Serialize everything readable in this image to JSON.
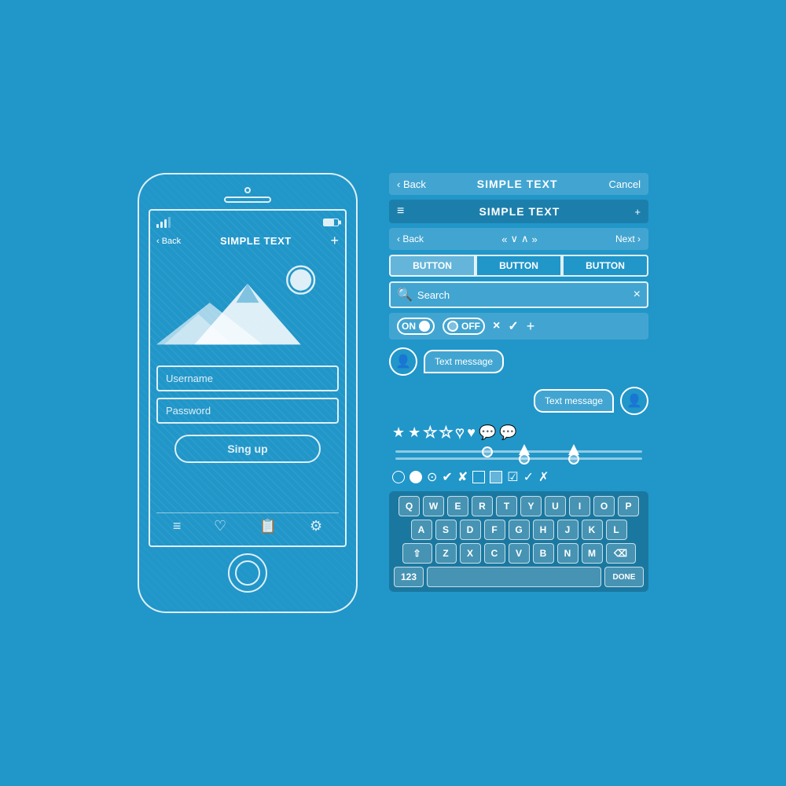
{
  "phone": {
    "nav": {
      "back_label": "‹ Back",
      "title": "SIMPLE TEXT",
      "plus_label": "+"
    },
    "status": {
      "signal": "signal",
      "battery": "battery"
    },
    "image_alt": "landscape photo placeholder",
    "username_placeholder": "Username",
    "password_placeholder": "Password",
    "signup_label": "Sing up",
    "tabs": [
      "menu",
      "heart",
      "list",
      "gear"
    ],
    "home_button": "home"
  },
  "ui_panel": {
    "row1": {
      "back": "‹ Back",
      "title": "SIMPLE TEXT",
      "cancel": "Cancel"
    },
    "row2": {
      "hamburger": "≡",
      "title": "SIMPLE TEXT",
      "plus": "+"
    },
    "row3": {
      "back": "‹ Back",
      "prev_prev": "«",
      "down": "∨",
      "up": "∧",
      "next_next": "»",
      "next": "Next ›"
    },
    "buttons": {
      "btn1": "BUTTON",
      "btn2": "BUTTON",
      "btn3": "BUTTON"
    },
    "search": {
      "placeholder": "Search",
      "clear": "×"
    },
    "toggles": {
      "on_label": "ON",
      "off_label": "OFF",
      "close": "×",
      "check": "✓",
      "plus": "+"
    },
    "chat": {
      "message1": "Text message",
      "message2": "Text message"
    },
    "stars": {
      "filled": 2,
      "half": 1,
      "empty": 2
    },
    "keyboard": {
      "row1": [
        "Q",
        "W",
        "E",
        "R",
        "T",
        "Y",
        "U",
        "I",
        "O",
        "P"
      ],
      "row2": [
        "A",
        "S",
        "D",
        "F",
        "G",
        "H",
        "J",
        "K",
        "L"
      ],
      "row3_special": "⇧",
      "row3": [
        "Z",
        "X",
        "C",
        "V",
        "B",
        "N",
        "M"
      ],
      "row3_del": "⌫",
      "numbers": "123",
      "space": "",
      "done": "DONE"
    }
  }
}
